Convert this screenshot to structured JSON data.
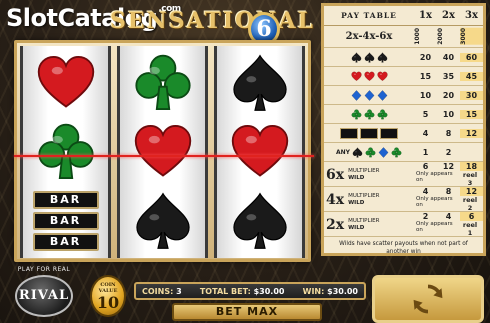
{
  "watermark": {
    "slot": "Slot",
    "catalog": "Catalog",
    "com": ".com"
  },
  "game": {
    "logo_text": "SENSATIONAL",
    "logo_number": "6"
  },
  "reels": [
    [
      "red-heart",
      "green-club",
      "bar-stack"
    ],
    [
      "green-club",
      "red-heart",
      "black-spade"
    ],
    [
      "black-spade",
      "red-heart",
      "black-spade"
    ]
  ],
  "bar_text": "BAR",
  "colors": {
    "heart": "#d41a1f",
    "club": "#1a8a2a",
    "spade": "#1a1a1a",
    "diamond": "#1e63d0",
    "payline": "#e0231f",
    "gold": "#c9a45a"
  },
  "paytable": {
    "title": "PAY TABLE",
    "columns": [
      "1x",
      "2x",
      "3x"
    ],
    "rows": [
      {
        "label": "2x-4x-6x",
        "values": [
          "1000",
          "2000",
          "3000"
        ]
      },
      {
        "icons": [
          "black-spade",
          "black-spade",
          "black-spade"
        ],
        "values": [
          "20",
          "40",
          "60"
        ]
      },
      {
        "icons": [
          "red-heart",
          "red-heart",
          "red-heart"
        ],
        "values": [
          "15",
          "35",
          "45"
        ]
      },
      {
        "icons": [
          "blue-diamond",
          "blue-diamond",
          "blue-diamond"
        ],
        "values": [
          "10",
          "20",
          "30"
        ]
      },
      {
        "icons": [
          "green-club",
          "green-club",
          "green-club"
        ],
        "values": [
          "5",
          "10",
          "15"
        ]
      },
      {
        "icons": [
          "bar",
          "bar",
          "bar"
        ],
        "values": [
          "4",
          "8",
          "12"
        ]
      },
      {
        "any": "ANY",
        "icons": [
          "black-spade",
          "green-club",
          "blue-diamond",
          "green-club"
        ],
        "values": [
          "1",
          "2",
          ""
        ]
      }
    ],
    "wild_rows": [
      {
        "big": "6x",
        "label1": "MULTIPLIER",
        "label2": "WILD",
        "values": [
          "6",
          "12",
          "18"
        ],
        "appears": "Only appears on",
        "reel": "reel 3"
      },
      {
        "big": "4x",
        "label1": "MULTIPLIER",
        "label2": "WILD",
        "values": [
          "4",
          "8",
          "12"
        ],
        "appears": "Only appears on",
        "reel": "reel 2"
      },
      {
        "big": "2x",
        "label1": "MULTIPLIER",
        "label2": "WILD",
        "values": [
          "2",
          "4",
          "6"
        ],
        "appears": "Only appears on",
        "reel": "reel 1"
      }
    ],
    "note": "Wilds have scatter payouts when not part of another win"
  },
  "branding": {
    "play_for_real": "PLAY FOR REAL",
    "logo": "RIVAL"
  },
  "coin": {
    "label": "COIN VALUE",
    "value": "10"
  },
  "info": {
    "coins_label": "COINS:",
    "coins_value": "3",
    "total_bet_label": "TOTAL BET:",
    "total_bet_value": "$30.00",
    "win_label": "WIN:",
    "win_value": "$30.00"
  },
  "buttons": {
    "bet_max": "BET MAX",
    "spin_icon": "spin-arrows-icon"
  }
}
